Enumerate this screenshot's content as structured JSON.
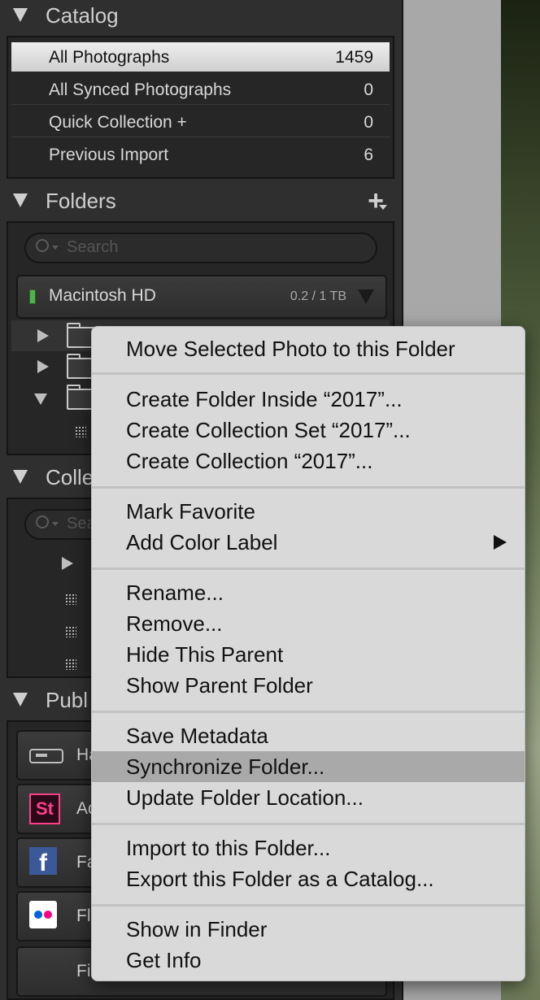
{
  "catalog": {
    "title": "Catalog",
    "items": [
      {
        "label": "All Photographs",
        "count": "1459"
      },
      {
        "label": "All Synced Photographs",
        "count": "0"
      },
      {
        "label": "Quick Collection  +",
        "count": "0"
      },
      {
        "label": "Previous Import",
        "count": "6"
      }
    ]
  },
  "folders": {
    "title": "Folders",
    "add_glyph": "+",
    "search_placeholder": "Search",
    "volume": {
      "name": "Macintosh HD",
      "size": "0.2 / 1 TB",
      "status_color": "#4fb34a"
    }
  },
  "collections": {
    "title": "Colle",
    "search_placeholder": "Sea"
  },
  "publish": {
    "title": "Publ",
    "services": [
      {
        "label": "Ha",
        "icon": "hard-drive-icon"
      },
      {
        "label": "Ad",
        "icon": "adobe-stock-icon",
        "icon_text": "St"
      },
      {
        "label": "Fa",
        "icon": "facebook-icon",
        "icon_text": "f"
      },
      {
        "label": "Fl",
        "icon": "flickr-icon"
      },
      {
        "label": "Fi",
        "icon": ""
      }
    ]
  },
  "context_menu": {
    "items": [
      {
        "label": "Move Selected Photo to this Folder"
      },
      {
        "label": "Create Folder Inside “2017”..."
      },
      {
        "label": "Create Collection Set “2017”..."
      },
      {
        "label": "Create Collection “2017”..."
      },
      {
        "label": "Mark Favorite"
      },
      {
        "label": "Add Color Label"
      },
      {
        "label": "Rename..."
      },
      {
        "label": "Remove..."
      },
      {
        "label": "Hide This Parent"
      },
      {
        "label": "Show Parent Folder"
      },
      {
        "label": "Save Metadata"
      },
      {
        "label": "Synchronize Folder..."
      },
      {
        "label": "Update Folder Location..."
      },
      {
        "label": "Import to this Folder..."
      },
      {
        "label": "Export this Folder as a Catalog..."
      },
      {
        "label": "Show in Finder"
      },
      {
        "label": "Get Info"
      }
    ],
    "highlight_color": "#a9a9a9"
  }
}
